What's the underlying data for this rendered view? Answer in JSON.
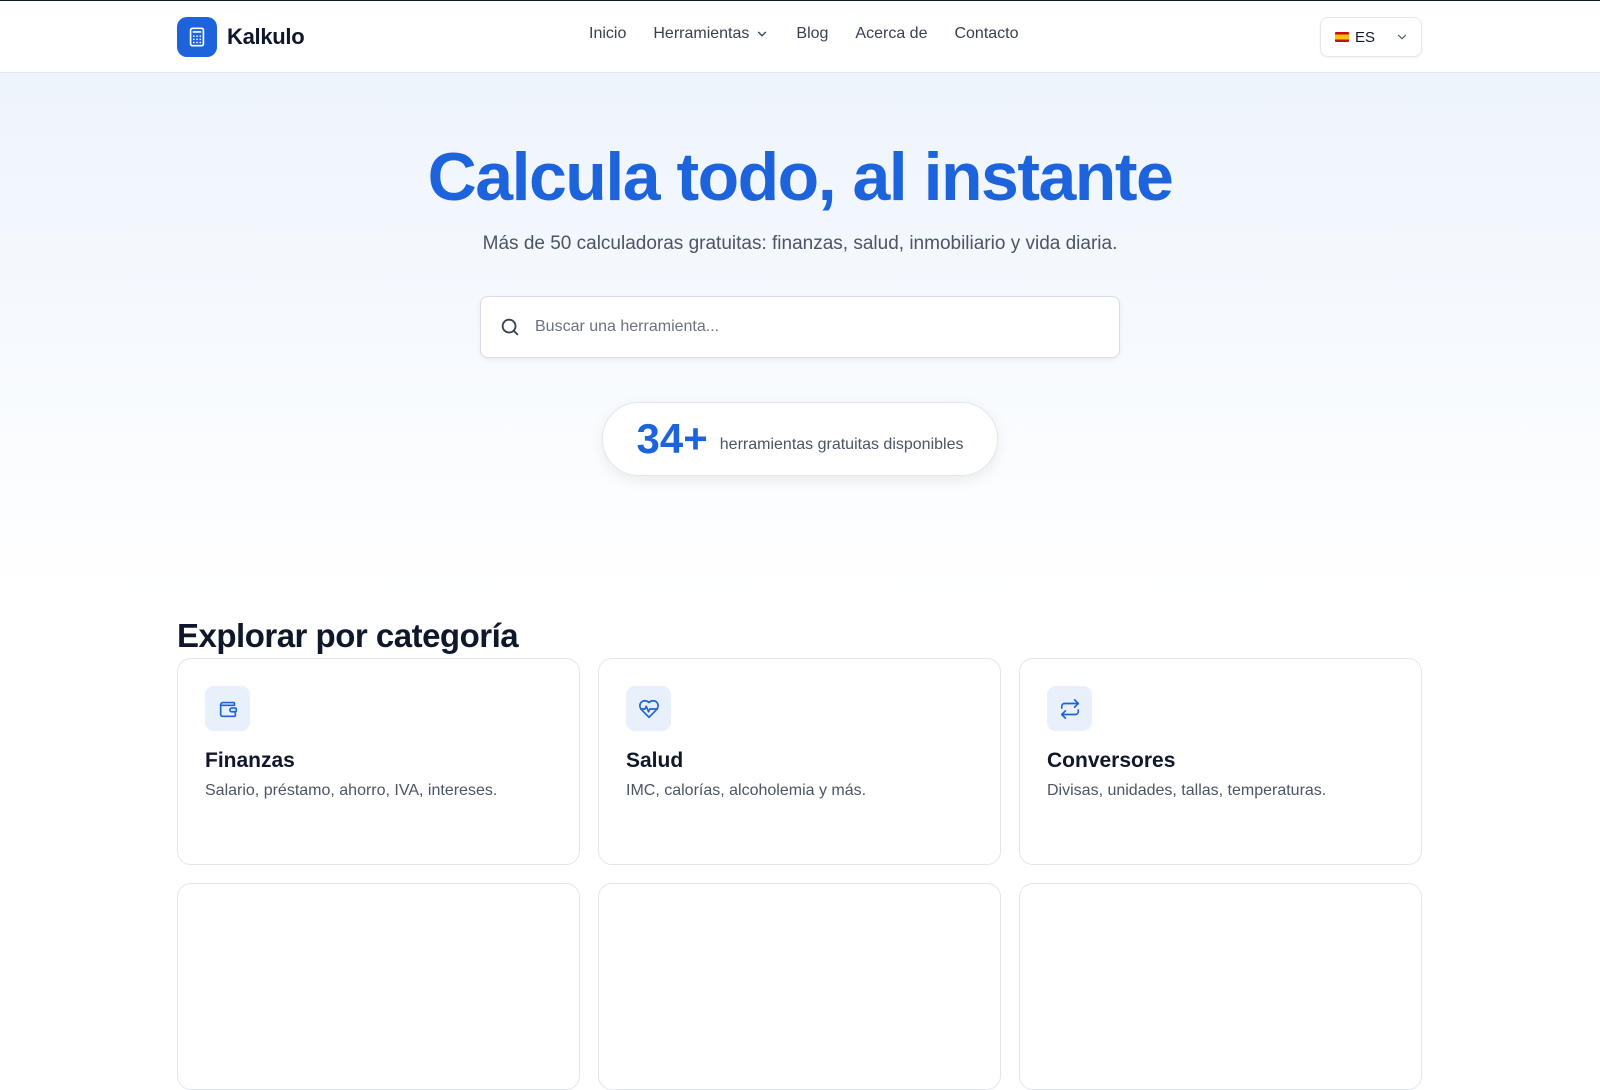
{
  "header": {
    "brand": "Kalkulo",
    "nav": [
      {
        "label": "Inicio"
      },
      {
        "label": "Herramientas",
        "has_dropdown": true
      },
      {
        "label": "Blog"
      },
      {
        "label": "Acerca de"
      },
      {
        "label": "Contacto"
      }
    ],
    "language": {
      "code": "ES",
      "flag": "spain-flag"
    }
  },
  "hero": {
    "title": "Calcula todo, al instante",
    "subtitle": "Más de 50 calculadoras gratuitas: finanzas, salud, inmobiliario y vida diaria.",
    "search_placeholder": "Buscar una herramienta...",
    "stat_number": "34+",
    "stat_label": "herramientas gratuitas disponibles"
  },
  "categories": {
    "title": "Explorar por categoría",
    "items": [
      {
        "name": "Finanzas",
        "description": "Salario, préstamo, ahorro, IVA, intereses.",
        "icon": "wallet-icon"
      },
      {
        "name": "Salud",
        "description": "IMC, calorías, alcoholemia y más.",
        "icon": "heart-pulse-icon"
      },
      {
        "name": "Conversores",
        "description": "Divisas, unidades, tallas, temperaturas.",
        "icon": "repeat-arrows-icon"
      }
    ]
  },
  "colors": {
    "accent": "#1d63dc",
    "icon_bg": "#e8f0fc"
  }
}
